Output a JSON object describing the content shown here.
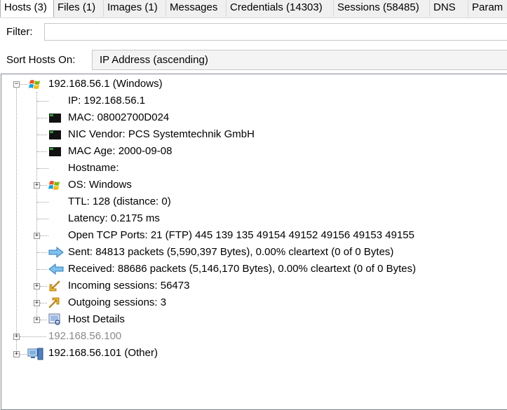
{
  "tabs": [
    {
      "label": "Hosts (3)"
    },
    {
      "label": "Files (1)"
    },
    {
      "label": "Images (1)"
    },
    {
      "label": "Messages"
    },
    {
      "label": "Credentials (14303)"
    },
    {
      "label": "Sessions (58485)"
    },
    {
      "label": "DNS"
    },
    {
      "label": "Param"
    }
  ],
  "filter": {
    "label": "Filter:",
    "value": ""
  },
  "sort": {
    "label": "Sort Hosts On:",
    "value": "IP Address (ascending)"
  },
  "tree": {
    "host1": {
      "label": "192.168.56.1 (Windows)",
      "ip": "IP: 192.168.56.1",
      "mac": "MAC: 08002700D024",
      "nic_vendor": "NIC Vendor: PCS Systemtechnik GmbH",
      "mac_age": "MAC Age: 2000-09-08",
      "hostname": "Hostname:",
      "os": "OS: Windows",
      "ttl": "TTL: 128 (distance: 0)",
      "latency": "Latency: 0.2175 ms",
      "open_tcp": "Open TCP Ports: 21 (FTP) 445 139 135 49154 49152 49156 49153 49155",
      "sent": "Sent: 84813 packets (5,590,397 Bytes), 0.00% cleartext (0 of 0 Bytes)",
      "received": "Received: 88686 packets (5,146,170 Bytes), 0.00% cleartext (0 of 0 Bytes)",
      "incoming": "Incoming sessions: 56473",
      "outgoing": "Outgoing sessions: 3",
      "host_details": "Host Details"
    },
    "host2": {
      "label": "192.168.56.100"
    },
    "host3": {
      "label": "192.168.56.101 (Other)"
    }
  }
}
